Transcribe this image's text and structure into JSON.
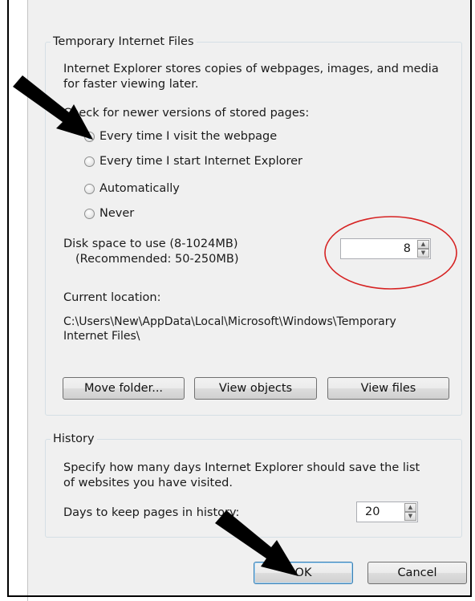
{
  "temp_files": {
    "title": "Temporary Internet Files",
    "description_line1": "Internet Explorer stores copies of webpages, images, and media",
    "description_line2": "for faster viewing later.",
    "check_label": "Check for newer versions of stored pages:",
    "options": [
      {
        "label": "Every time I visit the webpage",
        "checked": true
      },
      {
        "label": "Every time I start Internet Explorer",
        "checked": false
      },
      {
        "label": "Automatically",
        "checked": false
      },
      {
        "label": "Never",
        "checked": false
      }
    ],
    "disk_label": "Disk space to use (8-1024MB)",
    "disk_recommended": "(Recommended: 50-250MB)",
    "disk_value": "8",
    "location_label": "Current location:",
    "location_path_line1": "C:\\Users\\New\\AppData\\Local\\Microsoft\\Windows\\Temporary",
    "location_path_line2": "Internet Files\\",
    "buttons": {
      "move_folder": "Move folder...",
      "view_objects": "View objects",
      "view_files": "View files"
    }
  },
  "history": {
    "title": "History",
    "description_line1": "Specify how many days Internet Explorer should save the list",
    "description_line2": "of websites you have visited.",
    "days_label": "Days to keep pages in history:",
    "days_value": "20"
  },
  "footer": {
    "ok_label": "OK",
    "cancel_label": "Cancel"
  },
  "colors": {
    "annotation_circle": "#d62222",
    "annotation_arrow": "#000000"
  }
}
